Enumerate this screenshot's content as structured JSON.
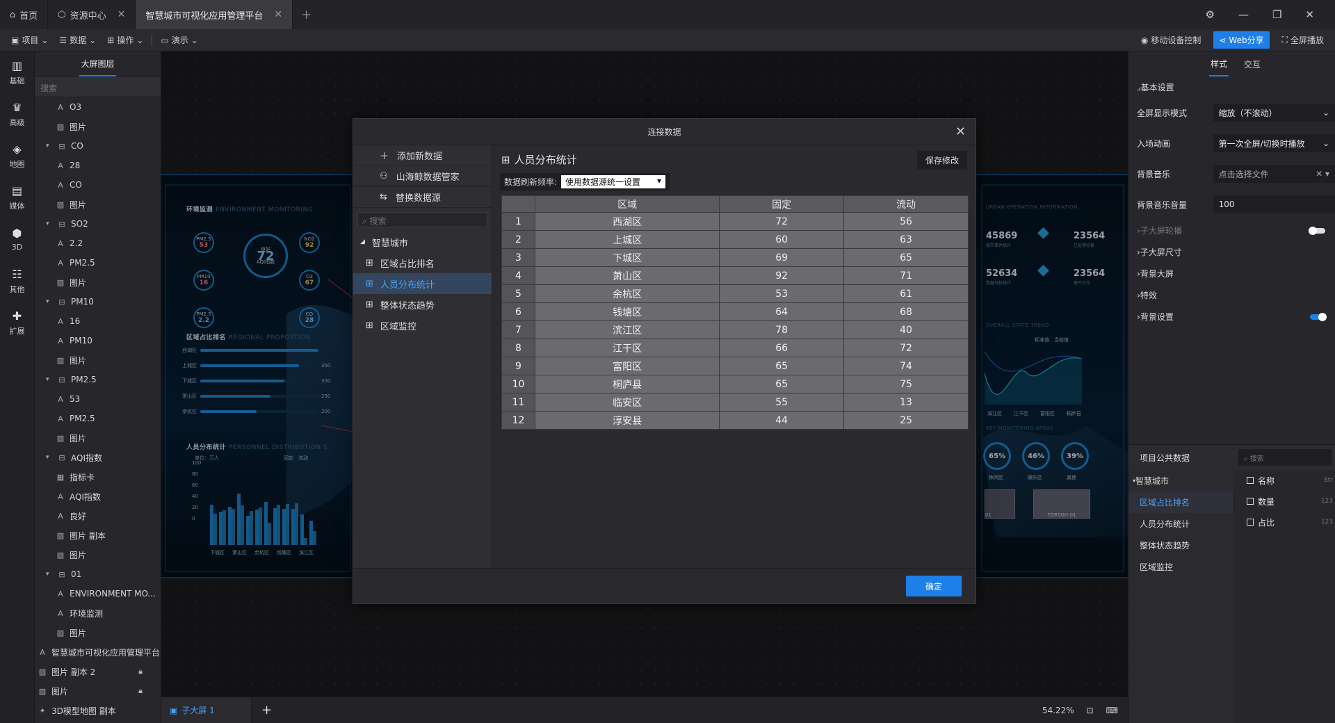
{
  "titlebar": {
    "tabs": [
      {
        "icon": "home-icon",
        "label": "首页"
      },
      {
        "icon": "cube-icon",
        "label": "资源中心"
      },
      {
        "label": "智慧城市可视化应用管理平台"
      }
    ]
  },
  "toolbar": {
    "menus": [
      "项目",
      "数据",
      "操作",
      "演示"
    ],
    "right": {
      "mobile": "移动设备控制",
      "web_share": "Web分享",
      "fullscreen": "全屏播放"
    }
  },
  "iconbar": [
    "基础",
    "高级",
    "地图",
    "媒体",
    "3D",
    "其他",
    "扩展"
  ],
  "layers": {
    "title": "大屏图层",
    "search_placeholder": "搜索",
    "rows": [
      {
        "indent": 1,
        "icon": "A",
        "label": "O3"
      },
      {
        "indent": 1,
        "icon": "img",
        "label": "图片"
      },
      {
        "indent": 0,
        "icon": "grp",
        "label": "CO",
        "expanded": true
      },
      {
        "indent": 1,
        "icon": "A",
        "label": "28"
      },
      {
        "indent": 1,
        "icon": "A",
        "label": "CO"
      },
      {
        "indent": 1,
        "icon": "img",
        "label": "图片"
      },
      {
        "indent": 0,
        "icon": "grp",
        "label": "SO2",
        "expanded": true
      },
      {
        "indent": 1,
        "icon": "A",
        "label": "2.2"
      },
      {
        "indent": 1,
        "icon": "A",
        "label": "PM2.5"
      },
      {
        "indent": 1,
        "icon": "img",
        "label": "图片"
      },
      {
        "indent": 0,
        "icon": "grp",
        "label": "PM10",
        "expanded": true
      },
      {
        "indent": 1,
        "icon": "A",
        "label": "16"
      },
      {
        "indent": 1,
        "icon": "A",
        "label": "PM10"
      },
      {
        "indent": 1,
        "icon": "img",
        "label": "图片"
      },
      {
        "indent": 0,
        "icon": "grp",
        "label": "PM2.5",
        "expanded": true
      },
      {
        "indent": 1,
        "icon": "A",
        "label": "53"
      },
      {
        "indent": 1,
        "icon": "A",
        "label": "PM2.5"
      },
      {
        "indent": 1,
        "icon": "img",
        "label": "图片"
      },
      {
        "indent": 0,
        "icon": "grp",
        "label": "AQI指数",
        "expanded": true
      },
      {
        "indent": 1,
        "icon": "card",
        "label": "指标卡"
      },
      {
        "indent": 1,
        "icon": "A",
        "label": "AQI指数"
      },
      {
        "indent": 1,
        "icon": "A",
        "label": "良好"
      },
      {
        "indent": 1,
        "icon": "img",
        "label": "图片 副本"
      },
      {
        "indent": 1,
        "icon": "img",
        "label": "图片"
      },
      {
        "indent": 0,
        "icon": "grp",
        "label": "01",
        "expanded": true
      },
      {
        "indent": 1,
        "icon": "A",
        "label": "ENVIRONMENT MO..."
      },
      {
        "indent": 1,
        "icon": "A",
        "label": "环境监测"
      },
      {
        "indent": 1,
        "icon": "img",
        "label": "图片"
      },
      {
        "indent": -1,
        "icon": "A",
        "label": "智慧城市可视化应用管理平台"
      },
      {
        "indent": -1,
        "icon": "img",
        "label": "图片 副本 2",
        "locked": true
      },
      {
        "indent": -1,
        "icon": "img",
        "label": "图片",
        "locked": true
      },
      {
        "indent": -1,
        "icon": "3d",
        "label": "3D模型地图 副本"
      }
    ]
  },
  "screen": {
    "env_title": "环境监测",
    "env_sub": "ENVIRONMENT MONITORING",
    "aqi": {
      "status": "良好",
      "value": "72",
      "label": "AQI指数"
    },
    "pollutants": [
      {
        "name": "PM2.5",
        "value": "53"
      },
      {
        "name": "NO2",
        "value": "92"
      },
      {
        "name": "PM10",
        "value": "16"
      },
      {
        "name": "O3",
        "value": "67"
      },
      {
        "name": "PM2.5",
        "value": "2.2"
      },
      {
        "name": "CO",
        "value": "28"
      }
    ],
    "rank_title": "区域占比排名",
    "rank_sub": "REGIONAL PROPORTION",
    "rank": [
      {
        "name": "西湖区",
        "value": 420
      },
      {
        "name": "上城区",
        "value": 350
      },
      {
        "name": "下城区",
        "value": 300
      },
      {
        "name": "萧山区",
        "value": 250
      },
      {
        "name": "余杭区",
        "value": 200
      }
    ],
    "rank_shown_values": [
      "350",
      "300",
      "250",
      "200"
    ],
    "dist_title": "人员分布统计",
    "dist_sub": "PERSONNEL DISTRIBUTION S",
    "dist_unit": "单位：万人",
    "dist_legend": [
      "固定",
      "流动"
    ],
    "dist_yticks": [
      "100",
      "80",
      "60",
      "40",
      "20",
      "0"
    ],
    "dist_xlabels": [
      "下城区",
      "萧山区",
      "余杭区",
      "钱塘区",
      "滨江区"
    ],
    "urban_title": "URBAN OPERATION INFORMATION",
    "stats": [
      {
        "value": "45869",
        "label": "城市事件统计"
      },
      {
        "value": "23564",
        "label": "已处理设备"
      },
      {
        "value": "52634",
        "label": "数据分析统计"
      },
      {
        "value": "23564",
        "label": "理千亿位"
      }
    ],
    "trend_title": "OVERALL STATE TREND",
    "trend_legend": [
      "标准值",
      "当前值"
    ],
    "trend_x": [
      "滨江区",
      "江干区",
      "富阳区",
      "桐庐县"
    ],
    "key_title": "KEY MONITORING AREAS",
    "gauges": [
      {
        "value": "65%",
        "label": "休闲区"
      },
      {
        "value": "46%",
        "label": "娱乐区"
      },
      {
        "value": "39%",
        "label": "其他"
      }
    ],
    "cams": [
      "01",
      "TDRSGH-01"
    ]
  },
  "modal": {
    "title": "连接数据",
    "actions": [
      {
        "icon": "plus-icon",
        "label": "添加新数据"
      },
      {
        "icon": "tree-icon",
        "label": "山海鲸数据管家"
      },
      {
        "icon": "swap-icon",
        "label": "替换数据源"
      }
    ],
    "search_placeholder": "搜索",
    "root": "智慧城市",
    "sources": [
      "区域占比排名",
      "人员分布统计",
      "整体状态趋势",
      "区域监控"
    ],
    "selected_index": 1,
    "ds_title": "人员分布统计",
    "save": "保存修改",
    "refresh_label": "数据刷新频率:",
    "refresh_value": "使用数据源统一设置",
    "columns": [
      "区域",
      "固定",
      "流动"
    ],
    "rows": [
      [
        "1",
        "西湖区",
        "72",
        "56"
      ],
      [
        "2",
        "上城区",
        "60",
        "63"
      ],
      [
        "3",
        "下城区",
        "69",
        "65"
      ],
      [
        "4",
        "萧山区",
        "92",
        "71"
      ],
      [
        "5",
        "余杭区",
        "53",
        "61"
      ],
      [
        "6",
        "钱塘区",
        "64",
        "68"
      ],
      [
        "7",
        "滨江区",
        "78",
        "40"
      ],
      [
        "8",
        "江干区",
        "66",
        "72"
      ],
      [
        "9",
        "富阳区",
        "65",
        "74"
      ],
      [
        "10",
        "桐庐县",
        "65",
        "75"
      ],
      [
        "11",
        "临安区",
        "55",
        "13"
      ],
      [
        "12",
        "淳安县",
        "44",
        "25"
      ]
    ],
    "ok": "确定"
  },
  "bottombar": {
    "subscreen": "子大屏 1",
    "zoom": "54.22%"
  },
  "rpanel": {
    "tabs": [
      "样式",
      "交互"
    ],
    "section": "基本设置",
    "fields": [
      {
        "label": "全屏显示模式",
        "value": "缩放（不滚动）",
        "type": "select"
      },
      {
        "label": "入场动画",
        "value": "第一次全屏/切换时播放",
        "type": "select"
      },
      {
        "label": "背景音乐",
        "value": "点击选择文件",
        "type": "file"
      },
      {
        "label": "背景音乐音量",
        "value": "100",
        "type": "input"
      }
    ],
    "items": [
      {
        "label": "子大屏轮播",
        "dim": true,
        "toggle": "off"
      },
      {
        "label": "子大屏尺寸"
      },
      {
        "label": "背景大屏"
      },
      {
        "label": "特效"
      },
      {
        "label": "背景设置",
        "toggle": "on"
      }
    ],
    "public": {
      "title": "项目公共数据",
      "search_placeholder": "搜索",
      "root": "智慧城市",
      "nodes": [
        "区域占比排名",
        "人员分布统计",
        "整体状态趋势",
        "区域监控"
      ],
      "selected_index": 0,
      "fields": [
        {
          "name": "名称",
          "type": "Str"
        },
        {
          "name": "数量",
          "type": "123"
        },
        {
          "name": "占比",
          "type": "123"
        }
      ]
    }
  }
}
